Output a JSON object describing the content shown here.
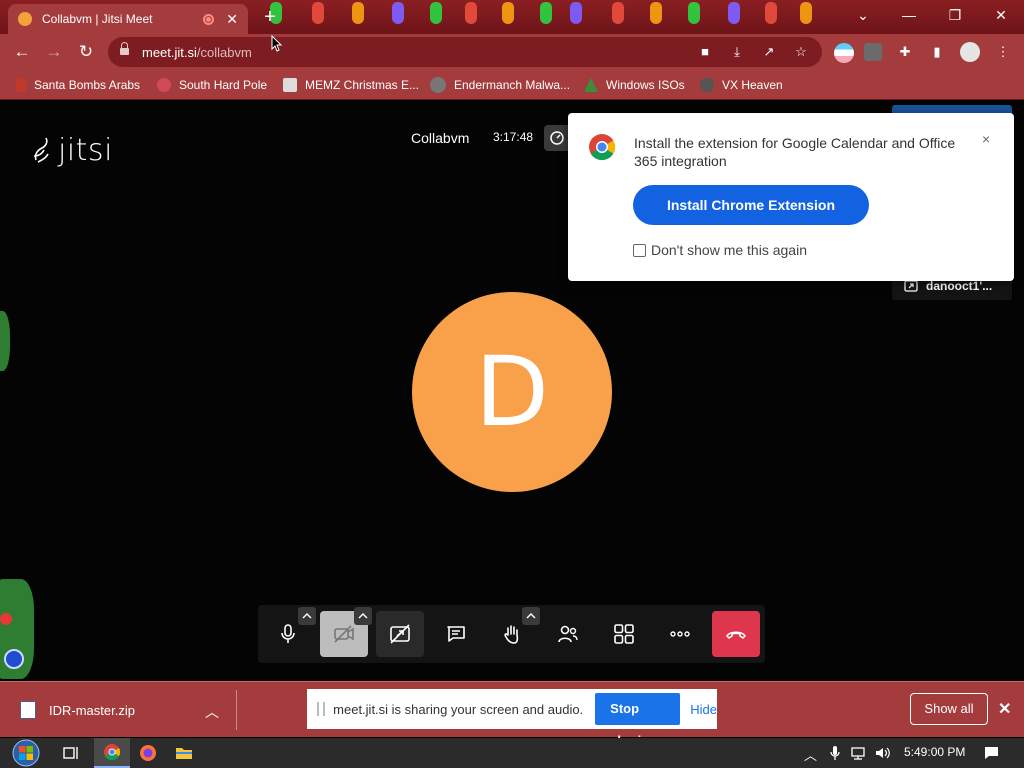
{
  "browser": {
    "tab": {
      "title": "Collabvm | Jitsi Meet"
    },
    "url_host": "meet.jit.si",
    "url_path": "/collabvm",
    "bookmarks": [
      {
        "label": "Santa Bombs Arabs",
        "icon": "reindeer-icon"
      },
      {
        "label": "South Hard Pole",
        "icon": "snowflake-icon"
      },
      {
        "label": "MEMZ Christmas E...",
        "icon": "memz-icon"
      },
      {
        "label": "Endermanch Malwa...",
        "icon": "endermanch-icon"
      },
      {
        "label": "Windows ISOs",
        "icon": "tree-icon"
      },
      {
        "label": "VX Heaven",
        "icon": "vx-heaven-icon"
      }
    ],
    "accent": "#a43b3d"
  },
  "meeting": {
    "logo": "jitsi",
    "name": "Collabvm",
    "duration": "3:17:48",
    "avatar_letter": "D",
    "avatar_color": "#f8a14a",
    "participant_name": "danooct1'..."
  },
  "extension_popup": {
    "text": "Install the extension for Google Calendar and Office 365 integration",
    "close": "×",
    "button": "Install Chrome Extension",
    "checkbox_label": "Don't show me this again"
  },
  "toolbox": {
    "buttons": [
      "microphone-icon",
      "camera-off-icon",
      "screenshare-icon",
      "chat-icon",
      "raise-hand-icon",
      "participants-icon",
      "tile-view-icon",
      "more-icon",
      "hangup-icon"
    ]
  },
  "download_bar": {
    "file": "IDR-master.zip",
    "share_text": "meet.jit.si is sharing your screen and audio.",
    "stop_sharing": "Stop sharing",
    "hide": "Hide",
    "show_all": "Show all"
  },
  "taskbar": {
    "time": "5:49:00 PM"
  }
}
